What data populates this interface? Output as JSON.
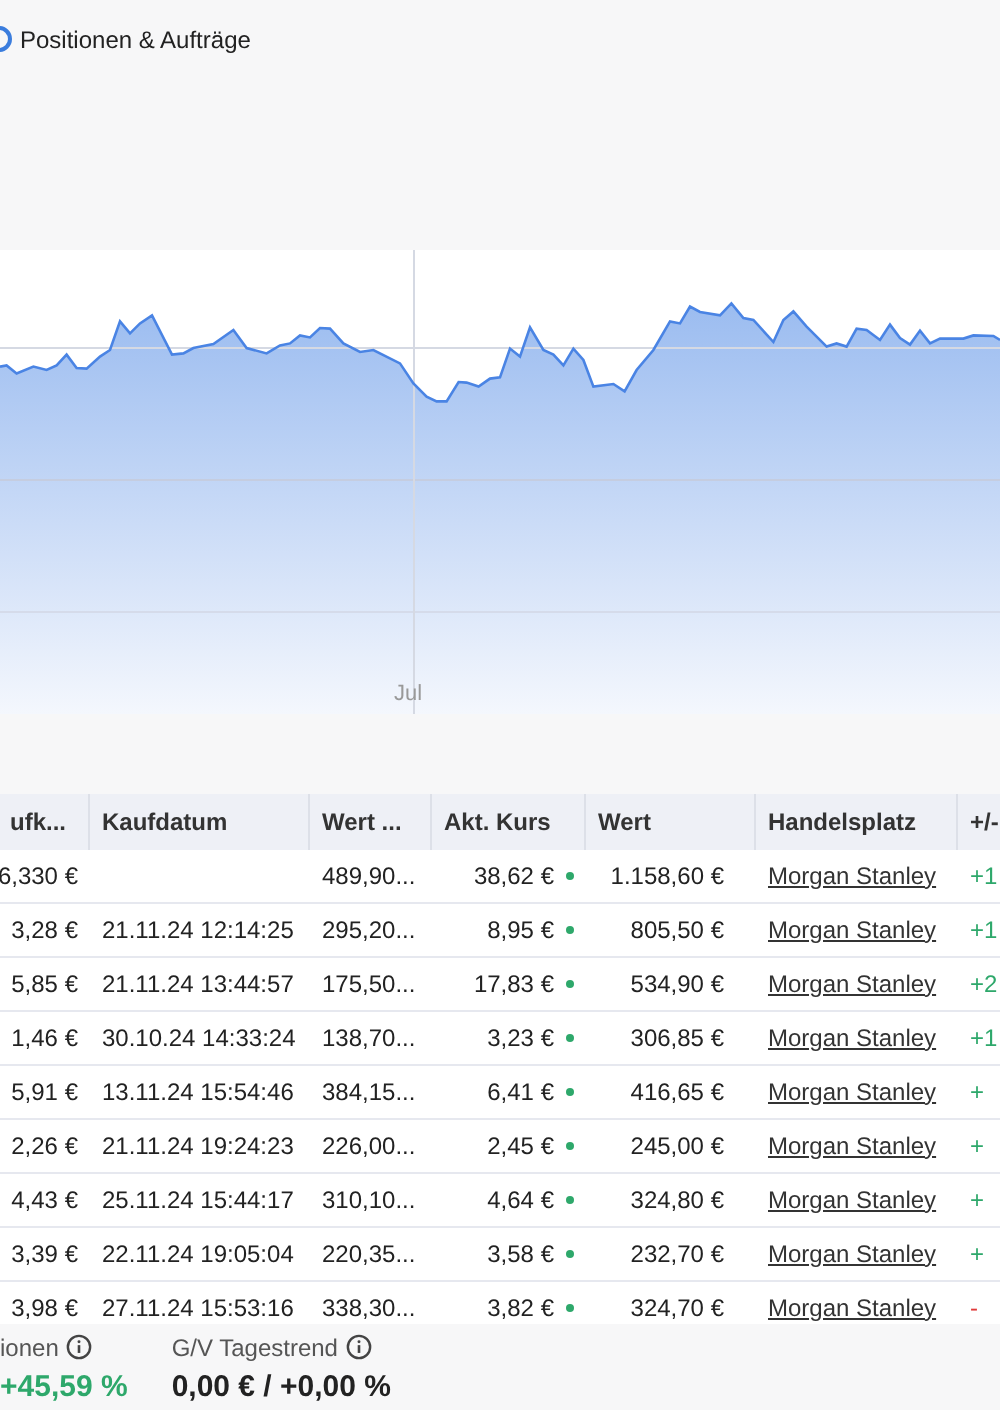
{
  "header": {
    "title": "Positionen & Aufträge"
  },
  "chart": {
    "xlabels": [
      "Jul"
    ]
  },
  "table": {
    "columns": [
      "ufk...",
      "Kaufdatum",
      "Wert ...",
      "Akt. Kurs",
      "Wert",
      "Handelsplatz",
      "+/-"
    ],
    "rows": [
      {
        "cells": [
          "6,330 €",
          "",
          "489,90...",
          "38,62 €",
          "1.158,60 €",
          "Morgan Stanley",
          "+1"
        ],
        "kind": "gain"
      },
      {
        "cells": [
          "3,28 €",
          "21.11.24 12:14:25",
          "295,20...",
          "8,95 €",
          "805,50 €",
          "Morgan Stanley",
          "+1"
        ],
        "kind": "gain"
      },
      {
        "cells": [
          "5,85 €",
          "21.11.24 13:44:57",
          "175,50...",
          "17,83 €",
          "534,90 €",
          "Morgan Stanley",
          "+2"
        ],
        "kind": "gain"
      },
      {
        "cells": [
          "1,46 €",
          "30.10.24 14:33:24",
          "138,70...",
          "3,23 €",
          "306,85 €",
          "Morgan Stanley",
          "+1"
        ],
        "kind": "gain"
      },
      {
        "cells": [
          "5,91 €",
          "13.11.24 15:54:46",
          "384,15...",
          "6,41 €",
          "416,65 €",
          "Morgan Stanley",
          "+"
        ],
        "kind": "gain"
      },
      {
        "cells": [
          "2,26 €",
          "21.11.24 19:24:23",
          "226,00...",
          "2,45 €",
          "245,00 €",
          "Morgan Stanley",
          "+"
        ],
        "kind": "gain"
      },
      {
        "cells": [
          "4,43 €",
          "25.11.24 15:44:17",
          "310,10...",
          "4,64 €",
          "324,80 €",
          "Morgan Stanley",
          "+"
        ],
        "kind": "gain"
      },
      {
        "cells": [
          "3,39 €",
          "22.11.24 19:05:04",
          "220,35...",
          "3,58 €",
          "232,70 €",
          "Morgan Stanley",
          "+"
        ],
        "kind": "gain"
      },
      {
        "cells": [
          "3,98 €",
          "27.11.24 15:53:16",
          "338,30...",
          "3,82 €",
          "324,70 €",
          "Morgan Stanley",
          "-"
        ],
        "kind": "loss"
      }
    ]
  },
  "summary": [
    {
      "label": "ionen",
      "value": "+45,59 %",
      "kind": "gain"
    },
    {
      "label": "G/V Tagestrend",
      "value": "0,00 € / +0,00 %",
      "kind": "neutral"
    }
  ]
}
